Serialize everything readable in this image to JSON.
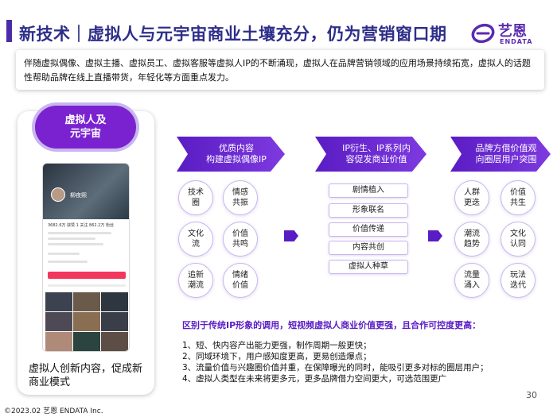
{
  "header": {
    "title": "新技术｜虚拟人与元宇宙商业土壤充分，仍为营销窗口期"
  },
  "logo": {
    "name_cn": "艺恩",
    "name_en": "ENDATA"
  },
  "intro": {
    "text": "伴随虚拟偶像、虚拟主播、虚拟员工、虚拟客服等虚拟人IP的不断涌现，虚拟人在品牌营销领域的应用场景持续拓宽，虚拟人的话题性帮助品牌在线上直播带货，年轻化等方面重点发力。"
  },
  "left_panel": {
    "pill_line1": "虚拟人及",
    "pill_line2": "元宇宙",
    "phone": {
      "name": "柳夜熙",
      "stats": "3682.6万 获赞  1 关注  862.2万 粉丝"
    },
    "caption": "虚拟人创新内容，促成新商业模式"
  },
  "flow": {
    "stage1": {
      "line1": "优质内容",
      "line2": "构建虚拟偶像IP"
    },
    "stage2": {
      "line1": "IP衍生、IP系列内",
      "line2": "容促发商业价值"
    },
    "stage3": {
      "line1": "品牌方借价值观",
      "line2": "向圈层用户突围"
    }
  },
  "col1": [
    {
      "line1": "技术",
      "line2": "圈"
    },
    {
      "line1": "文化",
      "line2": "流"
    },
    {
      "line1": "追新",
      "line2": "潮流"
    }
  ],
  "col2": [
    {
      "line1": "情感",
      "line2": "共振"
    },
    {
      "line1": "价值",
      "line2": "共鸣"
    },
    {
      "line1": "情绪",
      "line2": "价值"
    }
  ],
  "mid_bars": [
    "剧情植入",
    "形象联名",
    "价值传递",
    "内容共创",
    "虚拟人种草"
  ],
  "col3": [
    {
      "line1": "人群",
      "line2": "更迭"
    },
    {
      "line1": "潮流",
      "line2": "趋势"
    },
    {
      "line1": "流量",
      "line2": "涌入"
    }
  ],
  "col4": [
    {
      "line1": "价值",
      "line2": "共生"
    },
    {
      "line1": "文化",
      "line2": "认同"
    },
    {
      "line1": "玩法",
      "line2": "迭代"
    }
  ],
  "highlight": "区别于传统IP形象的调用，短视频虚拟人商业价值更强，且合作可控度更高：",
  "points": [
    "1、短、快内容产出能力更强，制作周期一般更快；",
    "2、同域环境下，用户感知度更高，更易创造爆点；",
    "3、流量价值与兴趣圈价值并重，在保障曝光的同时，能吸引更多对标的圈层用户；",
    "4、虚拟人类型在未来将更多元，更多品牌借力空间更大，可选范围更广"
  ],
  "page_number": "30",
  "footer": "©2023.02 艺恩 ENDATA Inc.",
  "colors": {
    "accent": "#5a1cc4",
    "title": "#2e2e8a",
    "light_border": "#c9b6ee"
  }
}
